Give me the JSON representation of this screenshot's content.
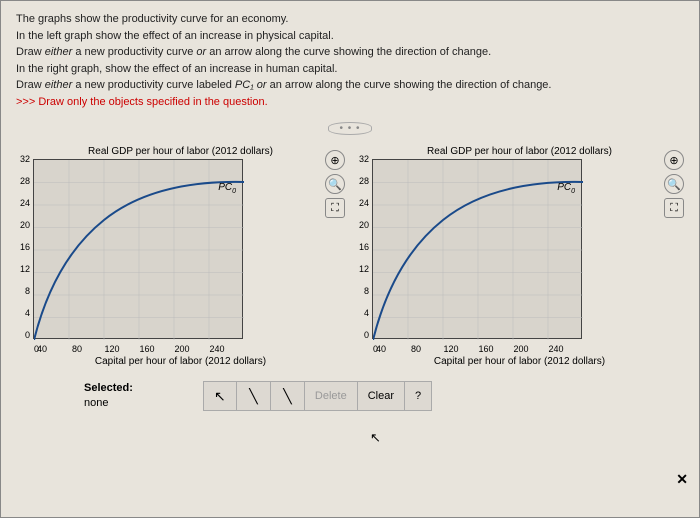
{
  "instructions": {
    "line1": "The graphs show the productivity curve for an economy.",
    "line2": "In the left graph show the effect of an increase in physical capital.",
    "line3a": "Draw ",
    "line3b": "either",
    "line3c": " a new productivity curve ",
    "line3d": "or",
    "line3e": " an arrow along the curve showing the direction of change.",
    "line4": "In the right graph, show the effect of an increase in human capital.",
    "line5a": "Draw ",
    "line5b": "either",
    "line5c": " a new productivity curve labeled ",
    "line5d": "PC₁",
    "line5e": " or",
    "line5f": " an arrow along the curve showing the direction of change.",
    "hint": ">>> Draw only the objects specified in the question."
  },
  "divider": "• • •",
  "graph": {
    "title": "Real GDP per hour of labor (2012 dollars)",
    "y_ticks": [
      "32",
      "28",
      "24",
      "20",
      "16",
      "12",
      "8",
      "4",
      "0"
    ],
    "x_ticks": [
      "0",
      "40",
      "80",
      "120",
      "160",
      "200",
      "240"
    ],
    "xlabel": "Capital per hour of labor (2012 dollars)",
    "curve_label": "PC",
    "curve_sub": "0"
  },
  "chart_data": [
    {
      "type": "line",
      "title": "Real GDP per hour of labor (2012 dollars)",
      "xlabel": "Capital per hour of labor (2012 dollars)",
      "ylabel": "Real GDP per hour of labor",
      "xlim": [
        0,
        240
      ],
      "ylim": [
        0,
        32
      ],
      "series": [
        {
          "name": "PC0",
          "x": [
            0,
            20,
            40,
            60,
            80,
            100,
            120,
            140,
            160,
            180,
            200,
            220,
            240
          ],
          "y": [
            0,
            9,
            14,
            18,
            21,
            23,
            24.5,
            25.6,
            26.4,
            27,
            27.4,
            27.7,
            28
          ]
        }
      ]
    },
    {
      "type": "line",
      "title": "Real GDP per hour of labor (2012 dollars)",
      "xlabel": "Capital per hour of labor (2012 dollars)",
      "ylabel": "Real GDP per hour of labor",
      "xlim": [
        0,
        240
      ],
      "ylim": [
        0,
        32
      ],
      "series": [
        {
          "name": "PC0",
          "x": [
            0,
            20,
            40,
            60,
            80,
            100,
            120,
            140,
            160,
            180,
            200,
            220,
            240
          ],
          "y": [
            0,
            9,
            14,
            18,
            21,
            23,
            24.5,
            25.6,
            26.4,
            27,
            27.4,
            27.7,
            28
          ]
        }
      ]
    }
  ],
  "tools": {
    "zoom_in": "⊕",
    "zoom_out": "🔍",
    "fullscreen": "⛶"
  },
  "selected": {
    "label": "Selected:",
    "value": "none"
  },
  "toolbar": {
    "arrow": "↖",
    "curve": "╲",
    "line": "╲",
    "delete": "Delete",
    "clear": "Clear",
    "help": "?"
  },
  "close": "✕"
}
